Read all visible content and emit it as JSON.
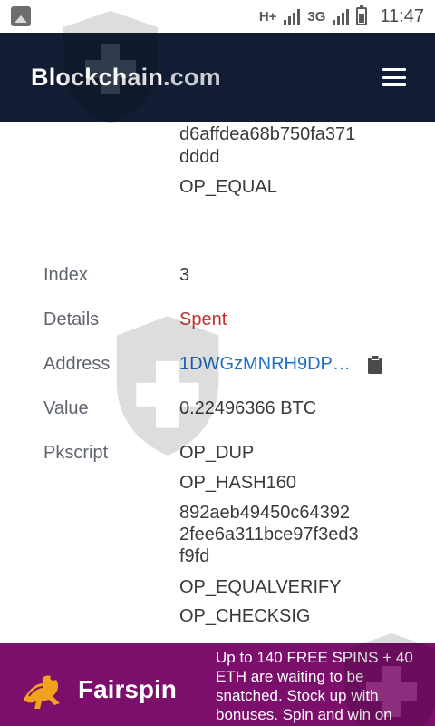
{
  "status_bar": {
    "network": "H+",
    "network2": "3G",
    "time": "11:47"
  },
  "header": {
    "brand_main": "Blockchain",
    "brand_tld": ".com",
    "menu_icon": "hamburger-menu-icon"
  },
  "previous_output": {
    "script_tail": [
      "d6affdea68b750fa371",
      "dddd",
      "OP_EQUAL"
    ]
  },
  "output": {
    "index_label": "Index",
    "index_value": "3",
    "details_label": "Details",
    "details_value": "Spent",
    "address_label": "Address",
    "address_value": "1DWGzMNRH9DP…",
    "value_label": "Value",
    "value_value": "0.22496366 BTC",
    "pkscript_label": "Pkscript",
    "pkscript": [
      "OP_DUP",
      "OP_HASH160",
      "892aeb49450c64392",
      "2fee6a311bce97f3ed3",
      "f9fd",
      "OP_EQUALVERIFY",
      "OP_CHECKSIG"
    ]
  },
  "ad": {
    "brand": "Fairspin",
    "text": "Up to 140 FREE SPINS + 40 ETH are waiting to be snatched. Stock up with bonuses. Spin and win on"
  },
  "colors": {
    "header_bg": "#121d33",
    "spent": "#c2312f",
    "link": "#1f6fc4",
    "ad_bg": "#7b0f6b"
  }
}
